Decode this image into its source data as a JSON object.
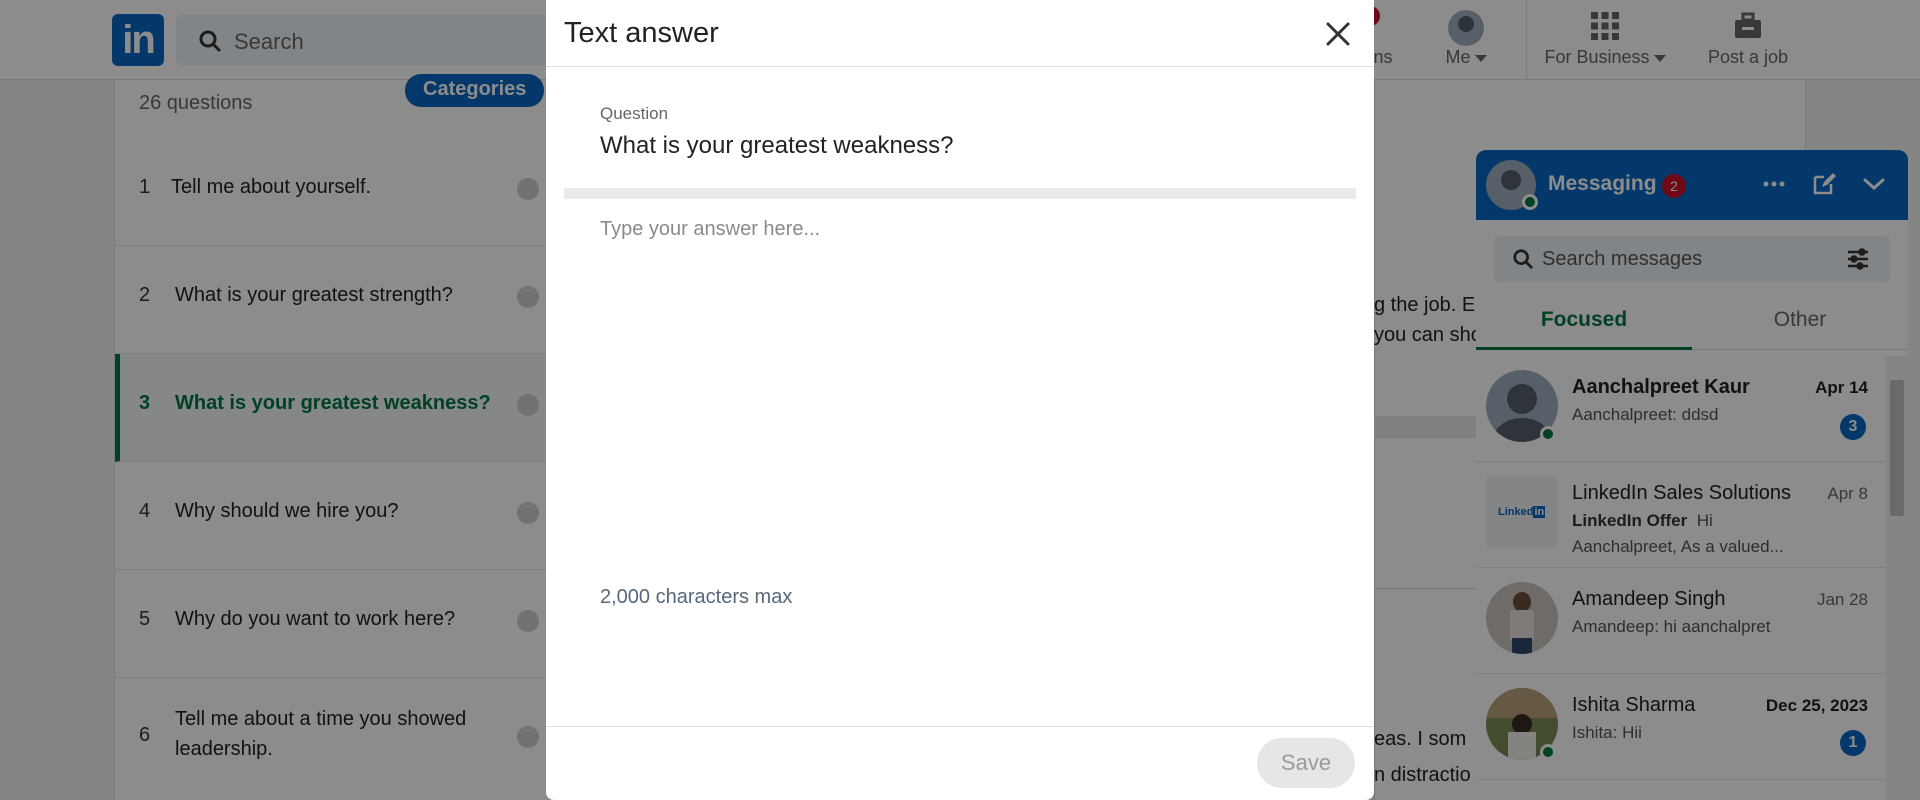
{
  "nav": {
    "search_placeholder": "Search",
    "items": [
      {
        "label": "ons"
      },
      {
        "label": "Me"
      },
      {
        "label": "For Business"
      },
      {
        "label": "Post a job"
      }
    ]
  },
  "questions": {
    "count_label": "26 questions",
    "categories_label": "Categories",
    "items": [
      {
        "num": "1",
        "text": "Tell me about yourself."
      },
      {
        "num": "2",
        "text": "What is your greatest strength?"
      },
      {
        "num": "3",
        "text": "What is your greatest weakness?"
      },
      {
        "num": "4",
        "text": "Why should we hire you?"
      },
      {
        "num": "5",
        "text": "Why do you want to work here?"
      },
      {
        "num": "6",
        "text": "Tell me about a time you showed leadership."
      }
    ],
    "active_index": 2
  },
  "background_text": {
    "line1": "g the job. E",
    "line2": "you can sho",
    "line3": "eas. I som",
    "line4": "n distractio"
  },
  "messaging": {
    "title": "Messaging",
    "unread": "2",
    "search_placeholder": "Search messages",
    "tabs": [
      "Focused",
      "Other"
    ],
    "conversations": [
      {
        "name": "Aanchalpreet Kaur",
        "date": "Apr 14",
        "preview": "Aanchalpreet: ddsd",
        "count": "3"
      },
      {
        "name": "LinkedIn Sales Solutions",
        "date": "Apr 8",
        "preview_bold": "LinkedIn Offer",
        "preview": "Hi",
        "preview2": "Aanchalpreet, As a valued..."
      },
      {
        "name": "Amandeep Singh",
        "date": "Jan 28",
        "preview": "Amandeep: hi aanchalpret"
      },
      {
        "name": "Ishita Sharma",
        "date": "Dec 25, 2023",
        "preview": "Ishita: Hii",
        "count": "1"
      }
    ]
  },
  "modal": {
    "title": "Text answer",
    "question_label": "Question",
    "question": "What is your greatest weakness?",
    "answer_placeholder": "Type your answer here...",
    "char_limit": "2,000 characters max",
    "save_label": "Save"
  },
  "colors": {
    "brand": "#0a66c2",
    "active_green": "#057642",
    "alert_red": "#cb112d"
  }
}
